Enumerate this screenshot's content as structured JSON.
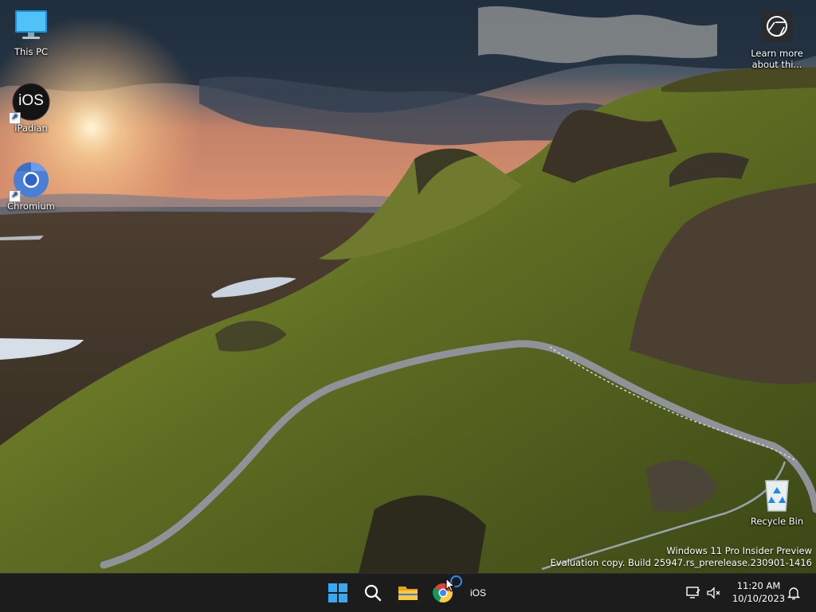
{
  "desktop": {
    "icons": [
      {
        "label": "This PC"
      },
      {
        "label": "iPadian",
        "logo_text": "iOS"
      },
      {
        "label": "Chromium"
      },
      {
        "label": "Learn more about thi..."
      },
      {
        "label": "Recycle Bin"
      }
    ],
    "watermark": {
      "line1": "Windows 11 Pro Insider Preview",
      "line2": "Evaluation copy. Build 25947.rs_prerelease.230901-1416"
    }
  },
  "taskbar": {
    "pinned": [
      {
        "icon": "windows-start-icon"
      },
      {
        "icon": "search-icon"
      },
      {
        "icon": "file-explorer-icon"
      },
      {
        "icon": "chrome-icon"
      },
      {
        "icon": "ipadian-icon",
        "text": "iOS"
      }
    ],
    "tray": {
      "time": "11:20 AM",
      "date": "10/10/2023"
    }
  },
  "colors": {
    "taskbar": "#1c1c1c",
    "accent": "#0078d4"
  }
}
